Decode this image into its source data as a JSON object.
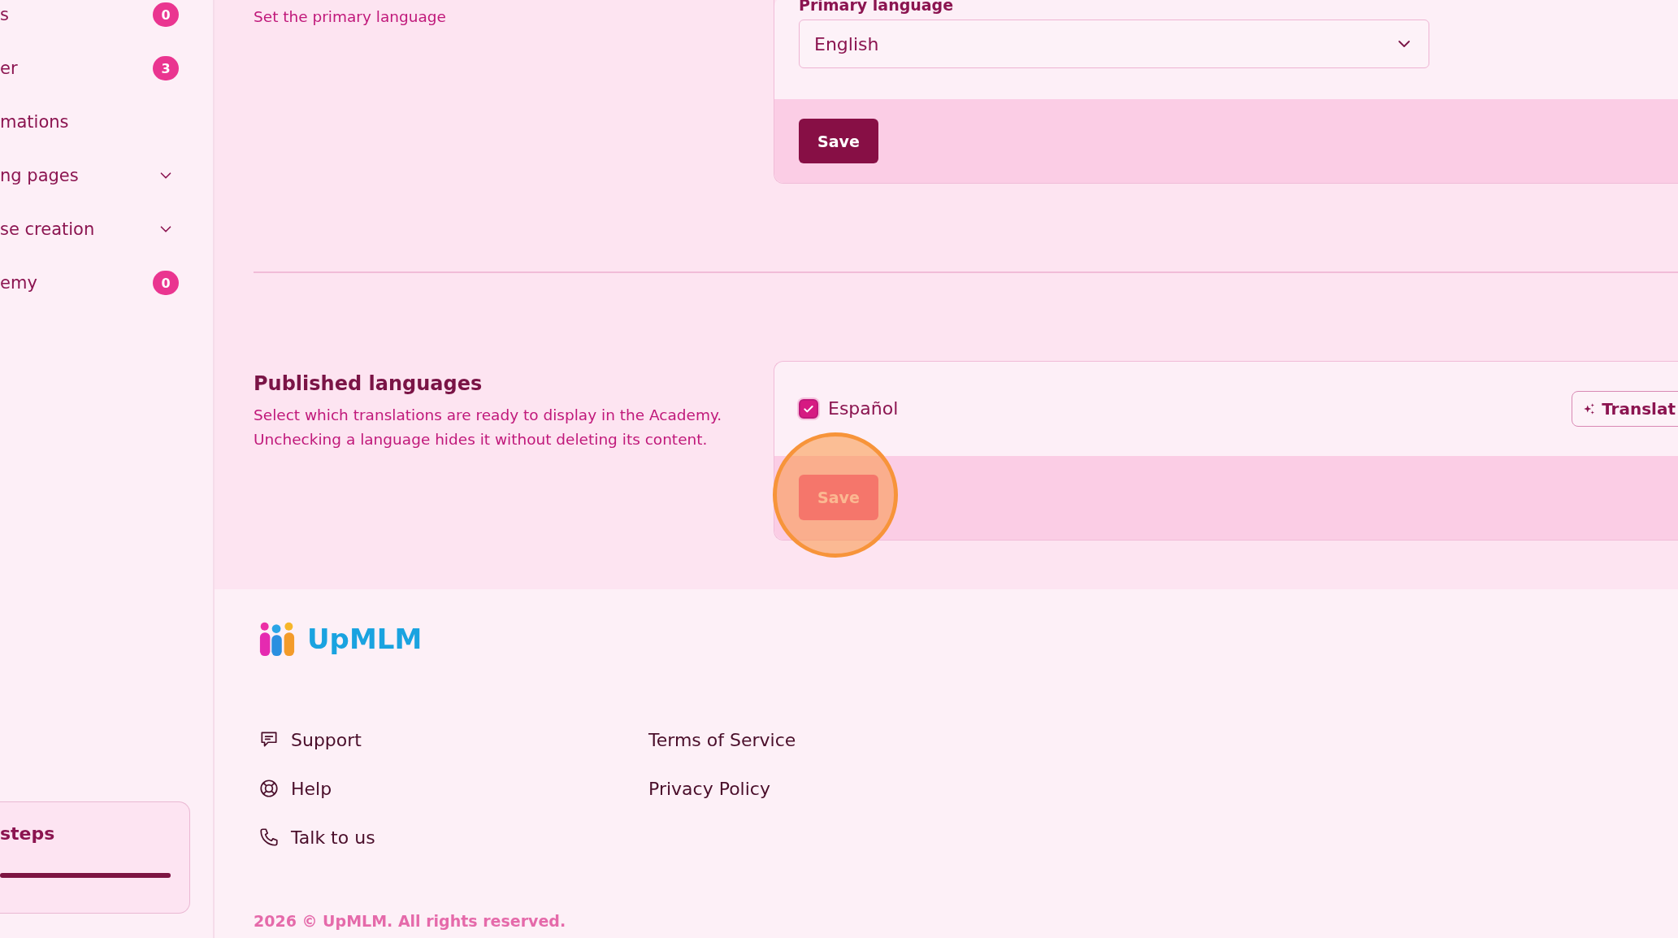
{
  "sidebar": {
    "items": [
      {
        "kind": "badge",
        "label": "s",
        "badge": "0"
      },
      {
        "kind": "badge",
        "label": "er",
        "badge": "3"
      },
      {
        "kind": "plain",
        "label": "mations"
      },
      {
        "kind": "group",
        "label": "ng pages",
        "expanded": false
      },
      {
        "kind": "group",
        "label": "se creation",
        "expanded": false
      },
      {
        "kind": "badge",
        "label": "emy",
        "badge": "0"
      }
    ],
    "steps_card": {
      "title": "steps",
      "progress": {
        "level": 1
      }
    }
  },
  "sections": [
    {
      "kind": "select",
      "description": "Set the primary language",
      "field": {
        "label": "Primary language",
        "value": "English"
      },
      "save": {
        "label": "Save",
        "highlighted": false
      }
    },
    {
      "kind": "checklist",
      "title": "Published languages",
      "description": "Select which translations are ready to display in the Academy. Unchecking a language hides it without deleting its content.",
      "languages": [
        {
          "label": "Español",
          "checked": true,
          "action": "Translat"
        }
      ],
      "save": {
        "label": "Save",
        "highlighted": true
      }
    }
  ],
  "footer": {
    "logo": "UpMLM",
    "links": [
      {
        "kind": "chat",
        "label": "Support"
      },
      {
        "kind": "lifebuoy",
        "label": "Help"
      },
      {
        "kind": "phone",
        "label": "Talk to us"
      }
    ],
    "legal": [
      "Terms of Service",
      "Privacy Policy"
    ],
    "copyright": "2026 © UpMLM. All rights reserved."
  }
}
